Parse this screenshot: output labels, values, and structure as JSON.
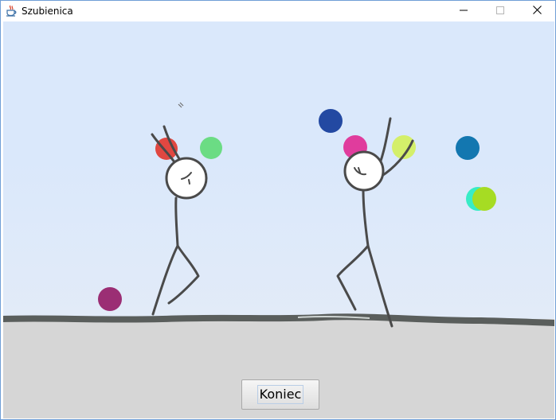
{
  "window": {
    "title": "Szubienica",
    "icon": "java-cup-icon",
    "controls": [
      "minimize-icon",
      "maximize-icon",
      "close-icon"
    ]
  },
  "scene": {
    "balls": [
      {
        "name": "ball-red",
        "color": "#e04741"
      },
      {
        "name": "ball-green",
        "color": "#6bdc84"
      },
      {
        "name": "ball-purple",
        "color": "#9b2e74"
      },
      {
        "name": "ball-navy",
        "color": "#2349a2"
      },
      {
        "name": "ball-pink",
        "color": "#e03c9d"
      },
      {
        "name": "ball-lime",
        "color": "#d4ef6a"
      },
      {
        "name": "ball-blue",
        "color": "#1377b0"
      },
      {
        "name": "ball-cyan",
        "color": "#38ecc6"
      },
      {
        "name": "ball-yellowgreen",
        "color": "#a6dc23"
      }
    ],
    "colors": {
      "sky": "#dae8fb",
      "ground": "#d6d6d6",
      "stroke": "#4a4a4a"
    }
  },
  "buttons": {
    "finish_label": "Koniec"
  }
}
